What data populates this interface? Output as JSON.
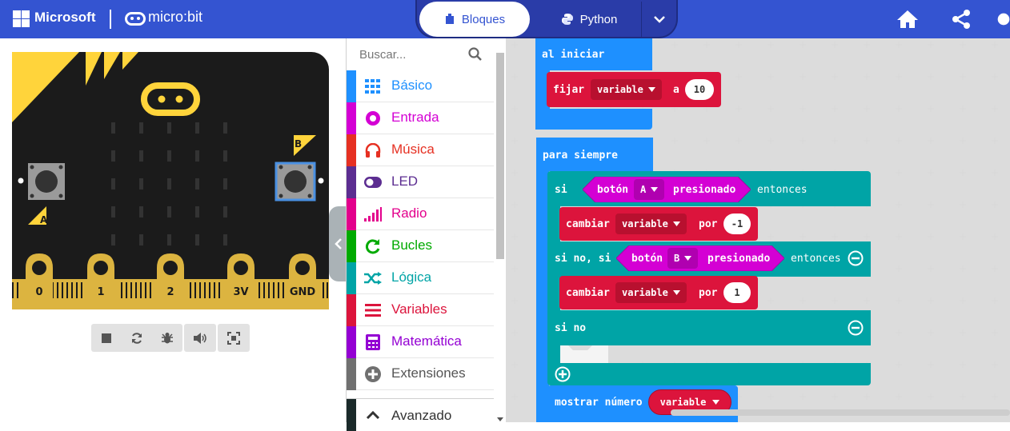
{
  "header": {
    "brand": "Microsoft",
    "product": "micro:bit",
    "modes": {
      "blocks": "Bloques",
      "python": "Python"
    }
  },
  "toolbox": {
    "search_placeholder": "Buscar...",
    "categories": [
      {
        "label": "Básico",
        "color": "#1E90FF",
        "icon": "grid-icon"
      },
      {
        "label": "Entrada",
        "color": "#D400D4",
        "icon": "target-icon"
      },
      {
        "label": "Música",
        "color": "#E63022",
        "icon": "headphones-icon"
      },
      {
        "label": "LED",
        "color": "#5C2D91",
        "icon": "toggle-icon"
      },
      {
        "label": "Radio",
        "color": "#E3008C",
        "icon": "signal-icon"
      },
      {
        "label": "Bucles",
        "color": "#00AA00",
        "icon": "refresh-icon"
      },
      {
        "label": "Lógica",
        "color": "#00A4A6",
        "icon": "shuffle-icon"
      },
      {
        "label": "Variables",
        "color": "#DC143C",
        "icon": "list-icon"
      },
      {
        "label": "Matemática",
        "color": "#9400D3",
        "icon": "calculator-icon"
      },
      {
        "label": "Extensiones",
        "color": "#707070",
        "icon": "plus-circle-icon"
      },
      {
        "label": "Avanzado",
        "color": "#1b2a2a",
        "icon": "chevron-up-icon"
      }
    ]
  },
  "simulator": {
    "pins": [
      "0",
      "1",
      "2",
      "3V",
      "GND"
    ],
    "button_a": "A",
    "button_b": "B"
  },
  "blocks": {
    "on_start": {
      "label": "al iniciar",
      "set": "fijar",
      "var": "variable",
      "to": "a",
      "value": "10"
    },
    "forever": {
      "label": "para siempre",
      "if": "si",
      "button": "botón",
      "btn_a": "A",
      "btn_b": "B",
      "pressed": "presionado",
      "then": "entonces",
      "change": "cambiar",
      "var": "variable",
      "by": "por",
      "val1": "-1",
      "val2": "1",
      "else_if": "si no, si",
      "else": "si no",
      "show": "mostrar número",
      "show_var": "variable"
    }
  },
  "colors": {
    "topbar": "#3454D1",
    "events": "#1E90FF",
    "logic": "#00A4A6",
    "variables": "#DC143C",
    "input": "#D400D4",
    "board": "#1b1b1b",
    "board_accent": "#FFD43B"
  }
}
